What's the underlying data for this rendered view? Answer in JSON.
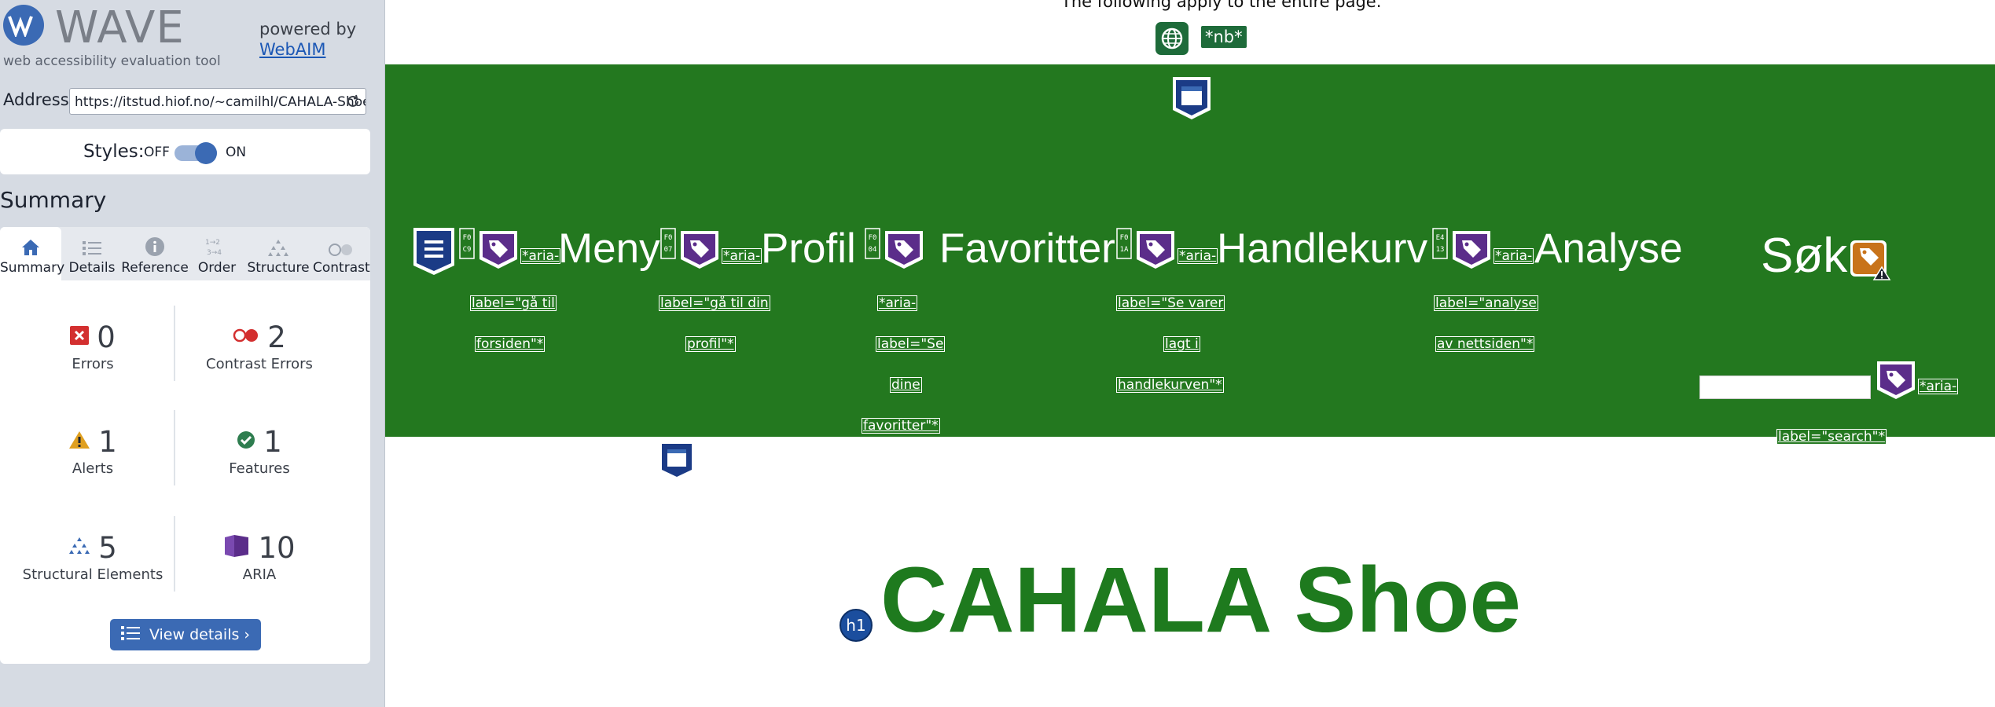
{
  "wave": {
    "logo_text": "WAVE",
    "tagline": "web accessibility evaluation tool",
    "powered_by": "powered by",
    "webaim_link": "WebAIM",
    "address_label": "Address:",
    "address_value": "https://itstud.hiof.no/~camilhl/CAHALA-Shoe",
    "styles_label": "Styles:",
    "styles_off": "OFF",
    "styles_on": "ON",
    "summary_title": "Summary",
    "tabs": [
      {
        "label": "Summary",
        "icon": "home-icon"
      },
      {
        "label": "Details",
        "icon": "list-icon"
      },
      {
        "label": "Reference",
        "icon": "info-icon"
      },
      {
        "label": "Order",
        "icon": "order-icon"
      },
      {
        "label": "Structure",
        "icon": "structure-icon"
      },
      {
        "label": "Contrast",
        "icon": "contrast-icon"
      }
    ],
    "stats": {
      "errors": {
        "value": "0",
        "label": "Errors"
      },
      "contrast": {
        "value": "2",
        "label": "Contrast Errors"
      },
      "alerts": {
        "value": "1",
        "label": "Alerts"
      },
      "features": {
        "value": "1",
        "label": "Features"
      },
      "structural": {
        "value": "5",
        "label": "Structural Elements"
      },
      "aria": {
        "value": "10",
        "label": "ARIA"
      }
    },
    "view_details": "View details ›",
    "colors": {
      "accent": "#3b6ab4",
      "error": "#d32f2f",
      "alert": "#e0a020",
      "feature": "#2e7d4f",
      "aria": "#5b2d8a"
    }
  },
  "page": {
    "top_note": "The following apply to the entire page.",
    "lang_tag": "*nb*",
    "nav_links": [
      "Meny",
      "Profil",
      "Favoritter",
      "Handlekurv",
      "Analyse",
      "Søk"
    ],
    "aria_prefix": "*aria-",
    "labels": {
      "meny": [
        "label=\"gå til",
        "forsiden\"*"
      ],
      "profil": [
        "label=\"gå til din",
        "profil\"*"
      ],
      "favoritter": [
        "*aria-",
        "label=\"Se",
        "dine",
        "favoritter\"*"
      ],
      "handlekurv": [
        "label=\"Se varer",
        "lagt i",
        "handlekurven\"*"
      ],
      "analyse": [
        "label=\"analyse",
        "av nettsiden\"*"
      ],
      "search": [
        "*aria-",
        "label=\"search\"*"
      ]
    },
    "tab_codes": [
      "F0 C9",
      "F0 07",
      "F0 04",
      "F0 1A",
      "E4 13"
    ],
    "heading": "CAHALA Shoe",
    "h1_badge": "h1",
    "colors": {
      "nav_bg": "#23781f",
      "heading": "#1e7a1e"
    }
  }
}
